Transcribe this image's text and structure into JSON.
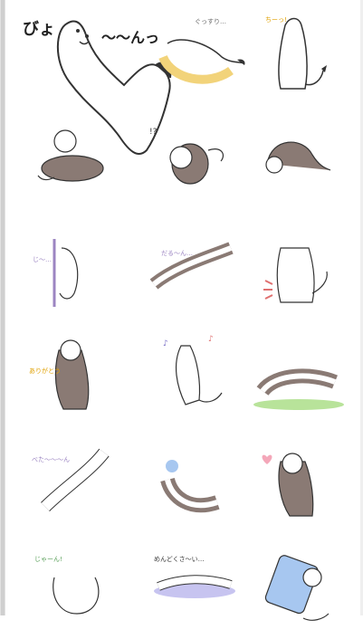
{
  "page": {
    "background": "#ffffff"
  },
  "hero": {
    "text_left": "びょ",
    "text_right": "〜〜んっ"
  },
  "stickers": [
    {
      "id": "r1c2",
      "label": "",
      "text": "ぐっすり…"
    },
    {
      "id": "r1c3",
      "label": "",
      "text": "ちーっ!"
    },
    {
      "id": "r2c1",
      "label": "",
      "text": ""
    },
    {
      "id": "r2c2",
      "label": "",
      "text": "!?"
    },
    {
      "id": "r2c3",
      "label": "",
      "text": ""
    },
    {
      "id": "r3c1",
      "label": "",
      "text": "じ〜…"
    },
    {
      "id": "r3c2",
      "label": "",
      "text": "だる〜ん…"
    },
    {
      "id": "r3c3",
      "label": "",
      "text": ""
    },
    {
      "id": "r4c1",
      "label": "",
      "text": "ありがとう"
    },
    {
      "id": "r4c2",
      "label": "",
      "text": "♪"
    },
    {
      "id": "r4c3",
      "label": "",
      "text": ""
    },
    {
      "id": "r5c1",
      "label": "",
      "text": "べた〜〜〜ん"
    },
    {
      "id": "r5c2",
      "label": "",
      "text": ""
    },
    {
      "id": "r5c3",
      "label": "",
      "text": ""
    },
    {
      "id": "r6c1",
      "label": "",
      "text": "じゃーん!"
    },
    {
      "id": "r6c2",
      "label": "",
      "text": "めんどくさ〜い…"
    },
    {
      "id": "r6c3",
      "label": "",
      "text": ""
    }
  ],
  "colors": {
    "body": "#ffffff",
    "outline": "#333333",
    "dark": "#8a7a74",
    "accent": "#f2d37a",
    "grass": "#b8e39a",
    "blue": "#a7c7f0"
  }
}
